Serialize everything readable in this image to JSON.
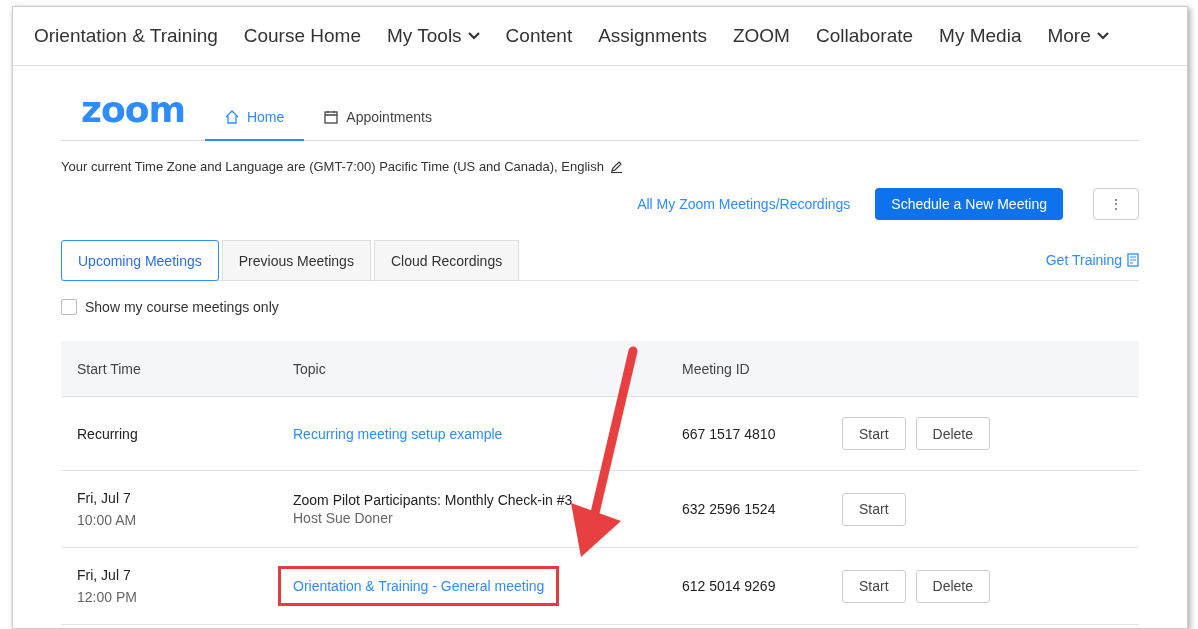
{
  "nav": {
    "items": [
      {
        "label": "Orientation & Training",
        "dropdown": false
      },
      {
        "label": "Course Home",
        "dropdown": false
      },
      {
        "label": "My Tools",
        "dropdown": true
      },
      {
        "label": "Content",
        "dropdown": false
      },
      {
        "label": "Assignments",
        "dropdown": false
      },
      {
        "label": "ZOOM",
        "dropdown": false
      },
      {
        "label": "Collaborate",
        "dropdown": false
      },
      {
        "label": "My Media",
        "dropdown": false
      },
      {
        "label": "More",
        "dropdown": true
      }
    ]
  },
  "zoom_header": {
    "logo": "zoom",
    "tabs": [
      {
        "label": "Home",
        "selected": true
      },
      {
        "label": "Appointments",
        "selected": false
      }
    ]
  },
  "timezone_note": "Your current Time Zone and Language are (GMT-7:00) Pacific Time (US and Canada), English",
  "actions": {
    "link": "All My Zoom Meetings/Recordings",
    "primary_button": "Schedule a New Meeting",
    "more_button": "⋮"
  },
  "meeting_tabs": [
    {
      "label": "Upcoming Meetings",
      "selected": true
    },
    {
      "label": "Previous Meetings",
      "selected": false
    },
    {
      "label": "Cloud Recordings",
      "selected": false
    }
  ],
  "get_training": "Get Training",
  "filter": {
    "label": "Show my course meetings only",
    "checked": false
  },
  "table": {
    "columns": [
      "Start Time",
      "Topic",
      "Meeting ID"
    ],
    "rows": [
      {
        "start": "Recurring",
        "topic": "Recurring meeting setup example",
        "topic_link": true,
        "meeting_id": "667 1517 4810",
        "buttons": [
          "Start",
          "Delete"
        ],
        "highlighted": false
      },
      {
        "start": "Fri, Jul 7",
        "time": "10:00 AM",
        "topic": "Zoom Pilot Participants: Monthly Check-in #3",
        "topic_link": false,
        "host": "Host Sue Doner",
        "meeting_id": "632 2596 1524",
        "buttons": [
          "Start"
        ],
        "highlighted": false
      },
      {
        "start": "Fri, Jul 7",
        "time": "12:00 PM",
        "topic": "Orientation & Training - General meeting",
        "topic_link": true,
        "meeting_id": "612 5014 9269",
        "buttons": [
          "Start",
          "Delete"
        ],
        "highlighted": true
      }
    ]
  }
}
